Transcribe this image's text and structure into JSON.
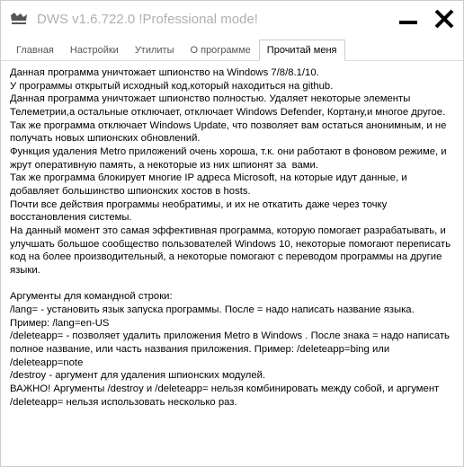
{
  "window": {
    "title": "DWS v1.6.722.0  !Professional mode!"
  },
  "tabs": {
    "items": [
      {
        "label": "Главная"
      },
      {
        "label": "Настройки"
      },
      {
        "label": "Утилиты"
      },
      {
        "label": "О программе"
      },
      {
        "label": "Прочитай меня"
      }
    ],
    "active_index": 4
  },
  "readme": {
    "text": "Данная программа уничтожает шпионство на Windows 7/8/8.1/10.\nУ программы открытый исходный код,который находиться на github.\nДанная программа уничтожает шпионство полностью. Удаляет некоторые элементы Телеметрии,а остальные отключает, отключает Windows Defender, Кортану,и многое другое. Так же программа отключает Windows Update, что позволяет вам остаться анонимным, и не получать новых шпионских обновлений.\nФункция удаления Metro приложений очень хороша, т.к. они работают в фоновом режиме, и жрут оперативную память, а некоторые из них шпионят за  вами.\nТак же программа блокирует многие IP адреса Microsoft, на которые идут данные, и добавляет большинство шпионских хостов в hosts.\nПочти все действия программы необратимы, и их не откатить даже через точку восстановления системы.\nНа данный момент это самая эффективная программа, которую помогает разрабатывать, и улучшать большое сообщество пользователей Windows 10, некоторые помогают переписать код на более производительный, а некоторые помогают с переводом программы на другие языки.\n\nАргументы для командной строки:\n/lang= - установить язык запуска программы. После = надо написать название языка. Пример: /lang=en-US\n/deleteapp= - позволяет удалить приложения Metro в Windows . После знака = надо написать полное название, или часть названия приложения. Пример: /deleteapp=bing или /deleteapp=note\n/destroy - аргумент для удаления шпионских модулей.\nВАЖНО! Аргументы /destroy и /deleteapp= нельзя комбинировать между собой, и аргумент /deleteapp= нельзя использовать несколько раз."
  }
}
